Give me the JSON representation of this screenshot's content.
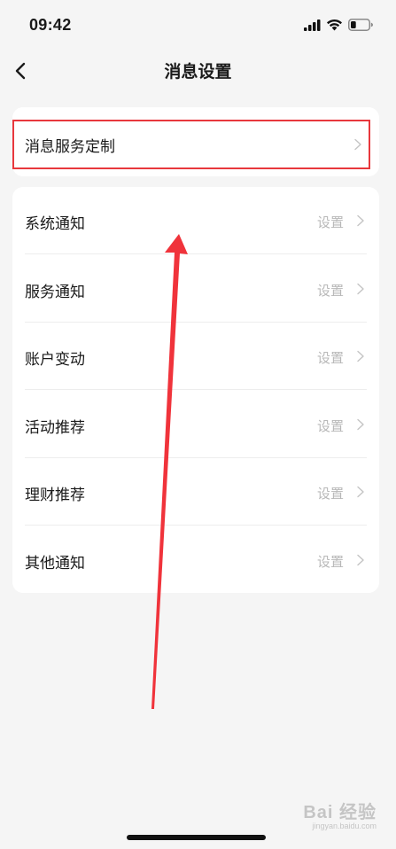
{
  "status_bar": {
    "time": "09:42",
    "signal_icon": "cellular-signal-icon",
    "wifi_icon": "wifi-icon",
    "battery_icon": "battery-icon",
    "battery_level": 0.3
  },
  "nav": {
    "back_icon": "chevron-left-icon",
    "title": "消息设置"
  },
  "custom_section": {
    "label": "消息服务定制",
    "chevron_icon": "chevron-right-icon",
    "highlight_color": "#e8383d"
  },
  "settings_list": [
    {
      "label": "系统通知",
      "value": "设置"
    },
    {
      "label": "服务通知",
      "value": "设置"
    },
    {
      "label": "账户变动",
      "value": "设置"
    },
    {
      "label": "活动推荐",
      "value": "设置"
    },
    {
      "label": "理财推荐",
      "value": "设置"
    },
    {
      "label": "其他通知",
      "value": "设置"
    }
  ],
  "annotation": {
    "color": "#f0333b",
    "type": "arrow-up"
  },
  "watermark": {
    "logo": "Bai 经验",
    "url": "jingyan.baidu.com"
  }
}
